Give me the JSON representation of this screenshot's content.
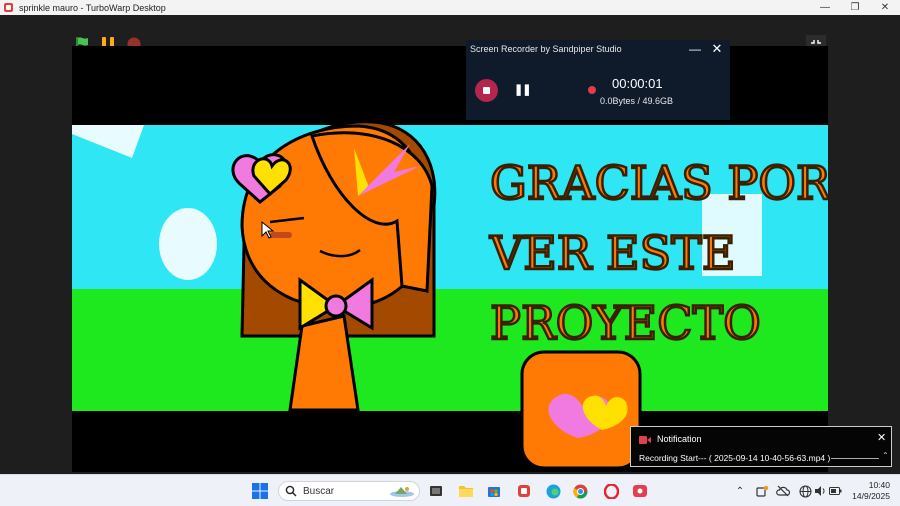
{
  "window": {
    "title": "sprinkle mauro - TurboWarp Desktop"
  },
  "stage": {
    "headline_lines": [
      "GRACIAS POR",
      "VER ESTE",
      "PROYECTO"
    ]
  },
  "recorder": {
    "title": "Screen Recorder by Sandpiper Studio",
    "time": "00:00:01",
    "size": "0.0Bytes / 49.6GB"
  },
  "notification": {
    "title": "Notification",
    "message": "Recording Start--- ( 2025-09-14 10-40-56-63.mp4 )"
  },
  "taskbar": {
    "search_label": "Buscar",
    "time": "10:40",
    "date": "14/9/2025"
  },
  "colors": {
    "sky": "#2ee6f4",
    "grass": "#1ee81e",
    "hair": "#ff7a05",
    "accent_pink": "#f07ae0",
    "accent_yellow": "#ffe000",
    "record_red": "#b3264e"
  }
}
